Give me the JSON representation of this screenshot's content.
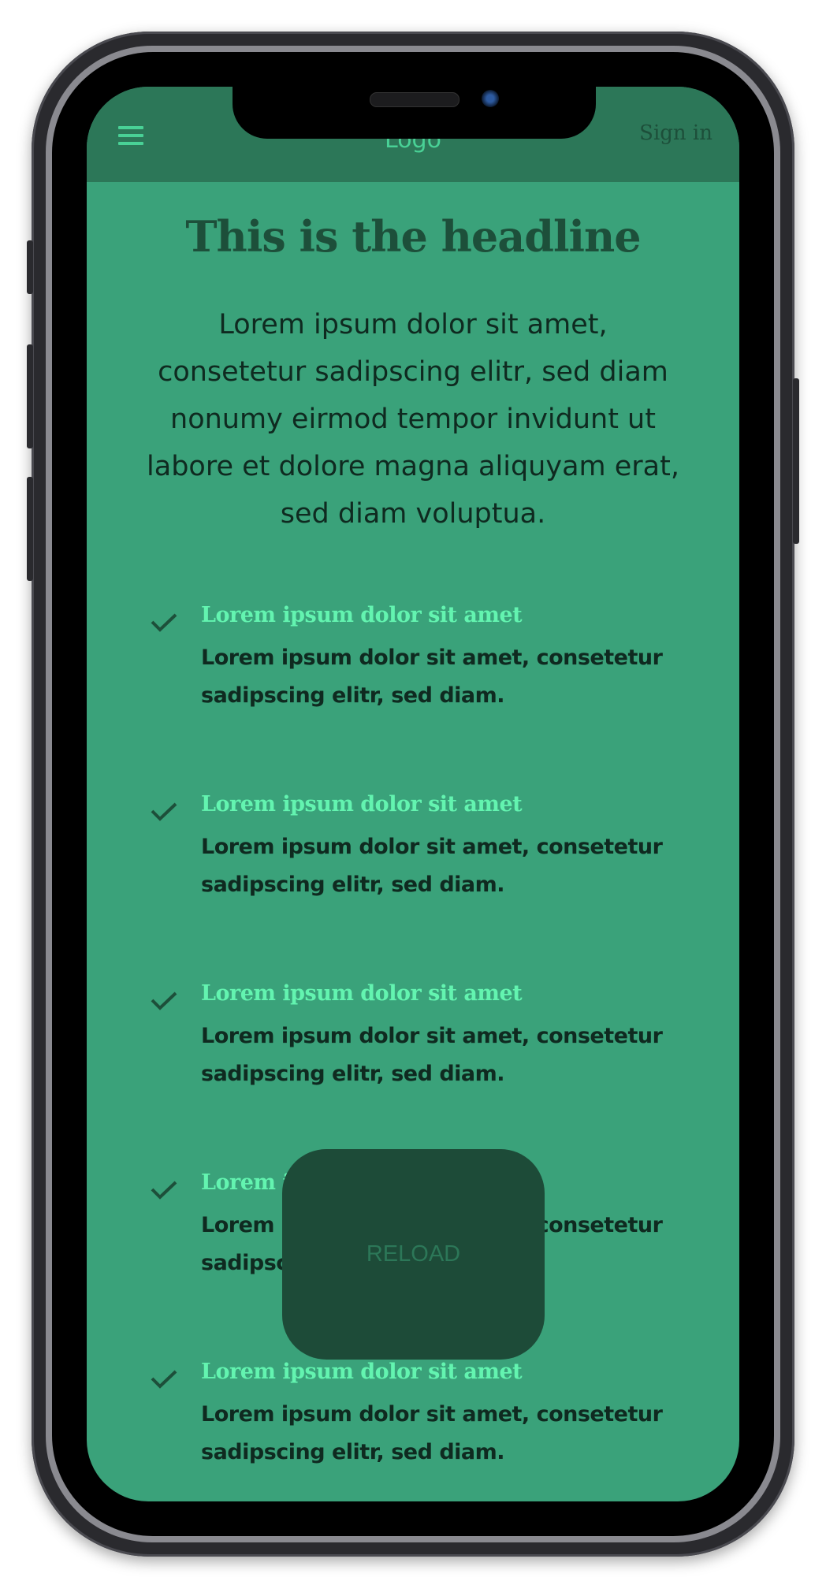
{
  "header": {
    "logo": "Logo",
    "sign_in": "Sign in",
    "menu_icon": "hamburger-icon"
  },
  "hero": {
    "headline": "This is the headline",
    "lead": "Lorem ipsum dolor sit amet, consetetur sadipscing elitr, sed diam nonumy eirmod tempor invidunt ut labore et dolore magna aliquyam erat, sed diam voluptua."
  },
  "features": [
    {
      "title": "Lorem ipsum dolor sit amet",
      "body": "Lorem ipsum dolor sit amet, consetetur sadipscing elitr, sed diam."
    },
    {
      "title": "Lorem ipsum dolor sit amet",
      "body": "Lorem ipsum dolor sit amet, consetetur sadipscing elitr, sed diam."
    },
    {
      "title": "Lorem ipsum dolor sit amet",
      "body": "Lorem ipsum dolor sit amet, consetetur sadipscing elitr, sed diam."
    },
    {
      "title": "Lorem ipsum dolor sit amet",
      "body": "Lorem ipsum dolor sit amet, consetetur sadipscing elitr, sed diam."
    },
    {
      "title": "Lorem ipsum dolor sit amet",
      "body": "Lorem ipsum dolor sit amet, consetetur sadipscing elitr, sed diam."
    }
  ],
  "overlay": {
    "reload_label": "RELOAD"
  },
  "colors": {
    "header": "#2c7758",
    "background": "#3aa27a",
    "accent": "#63f4b0",
    "dark": "#1d4f3a",
    "reload_bg": "#1d4b38"
  }
}
